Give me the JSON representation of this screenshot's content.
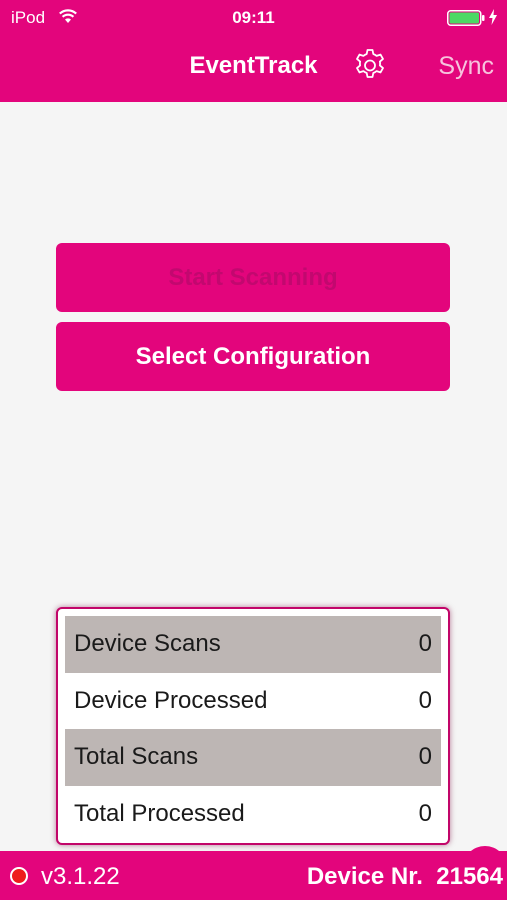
{
  "status_bar": {
    "carrier": "iPod",
    "time": "09:11",
    "wifi_icon": "wifi-icon",
    "battery_icon": "battery-icon",
    "charging_icon": "charging-bolt-icon",
    "battery_level": 1.0,
    "battery_color": "#4cd964"
  },
  "nav": {
    "title": "EventTrack",
    "settings_icon": "gear-icon",
    "sync_label": "Sync"
  },
  "actions": {
    "start_scanning_label": "Start Scanning",
    "start_scanning_enabled": false,
    "select_configuration_label": "Select Configuration"
  },
  "stats": [
    {
      "label": "Device Scans",
      "value": "0"
    },
    {
      "label": "Device Processed",
      "value": "0"
    },
    {
      "label": "Total Scans",
      "value": "0"
    },
    {
      "label": "Total Processed",
      "value": "0"
    }
  ],
  "footer": {
    "recording_indicator": "record-dot-icon",
    "version": "v3.1.22",
    "device_label": "Device Nr.",
    "device_number": "21564"
  },
  "colors": {
    "brand": "#e3057c",
    "background": "#f5f5f5",
    "row_shade": "#bdb6b4",
    "record_dot": "#ee1c1c"
  }
}
